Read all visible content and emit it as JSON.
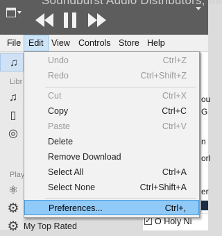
{
  "topbar": {
    "scrolling_text": "Soundburst Audio Distributors, Inc.",
    "buttons": {
      "menu": "window-menu",
      "rewind": "rewind",
      "pause": "pause",
      "forward": "fast-forward"
    }
  },
  "menubar": {
    "items": [
      "File",
      "Edit",
      "View",
      "Controls",
      "Store",
      "Help"
    ],
    "active": "Edit"
  },
  "sidebar": {
    "headers": {
      "library": "Libr",
      "playlists": "Play"
    },
    "bottom_item": "My Top Rated"
  },
  "content_fragments": [
    "ou",
    "G",
    "n",
    "orl",
    "er",
    "N",
    "O Holy Ni"
  ],
  "edit_menu": {
    "items": [
      {
        "label": "Undo",
        "shortcut": "Ctrl+Z",
        "enabled": false
      },
      {
        "label": "Redo",
        "shortcut": "Ctrl+Shift+Z",
        "enabled": false
      },
      {
        "label": "Cut",
        "shortcut": "Ctrl+X",
        "enabled": false
      },
      {
        "label": "Copy",
        "shortcut": "Ctrl+C",
        "enabled": true
      },
      {
        "label": "Paste",
        "shortcut": "Ctrl+V",
        "enabled": false
      },
      {
        "label": "Delete",
        "shortcut": "",
        "enabled": true
      },
      {
        "label": "Remove Download",
        "shortcut": "",
        "enabled": true
      },
      {
        "label": "Select All",
        "shortcut": "Ctrl+A",
        "enabled": true
      },
      {
        "label": "Select None",
        "shortcut": "Ctrl+Shift+A",
        "enabled": true
      },
      {
        "label": "Preferences...",
        "shortcut": "Ctrl+,",
        "enabled": true,
        "highlighted": true
      }
    ]
  },
  "colors": {
    "menu_highlight": "#91c9f7",
    "topbar_bg": "#5d5d5d",
    "menubar_bg": "#f0f0f0"
  }
}
